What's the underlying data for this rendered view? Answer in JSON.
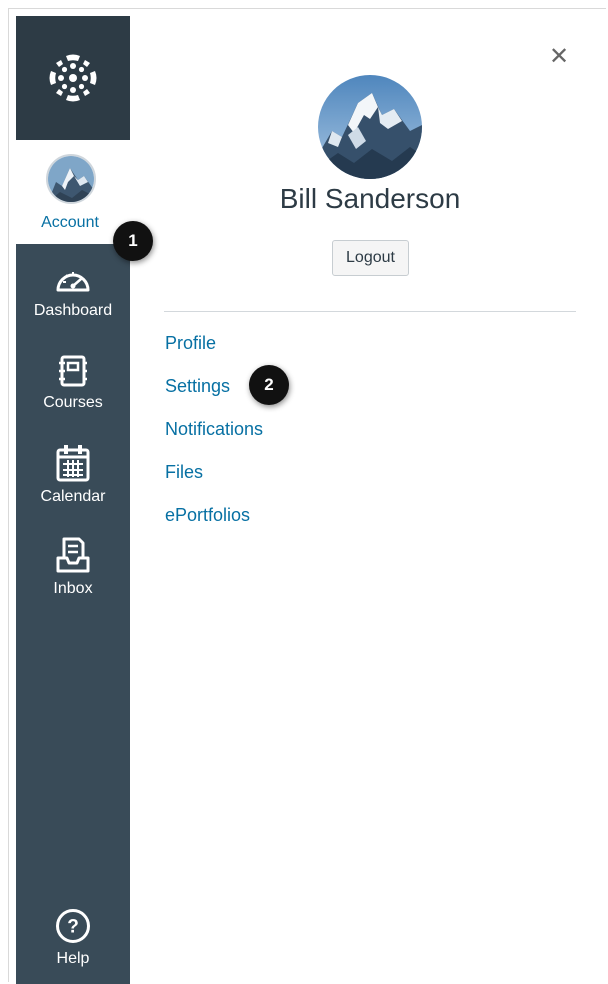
{
  "nav": {
    "logo_icon": "canvas-logo-icon",
    "account": {
      "label": "Account",
      "icon": "user-avatar"
    },
    "items": [
      {
        "label": "Dashboard",
        "icon": "dashboard-gauge-icon"
      },
      {
        "label": "Courses",
        "icon": "courses-notebook-icon"
      },
      {
        "label": "Calendar",
        "icon": "calendar-icon"
      },
      {
        "label": "Inbox",
        "icon": "inbox-icon"
      }
    ],
    "help": {
      "label": "Help",
      "icon": "help-circle-icon"
    }
  },
  "tray": {
    "close_icon": "close-icon",
    "user_name": "Bill Sanderson",
    "logout_label": "Logout",
    "links": [
      "Profile",
      "Settings",
      "Notifications",
      "Files",
      "ePortfolios"
    ]
  },
  "callouts": {
    "first": "1",
    "second": "2"
  },
  "colors": {
    "nav_bg": "#394b58",
    "nav_logo_bg": "#2d3b45",
    "link": "#0770a3",
    "text": "#2d3b45"
  }
}
